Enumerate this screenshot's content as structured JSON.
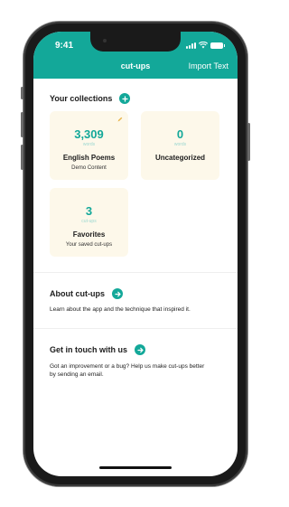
{
  "status_bar": {
    "time": "9:41"
  },
  "nav": {
    "title": "cut-ups",
    "action": "Import Text"
  },
  "collections": {
    "heading": "Your collections",
    "cards": [
      {
        "count": "3,309",
        "unit": "words",
        "title": "English Poems",
        "subtitle": "Demo Content"
      },
      {
        "count": "0",
        "unit": "words",
        "title": "Uncategorized",
        "subtitle": ""
      },
      {
        "count": "3",
        "unit": "cut-ups",
        "title": "Favorites",
        "subtitle": "Your saved cut-ups"
      }
    ]
  },
  "about": {
    "heading": "About cut-ups",
    "text": "Learn about the app and the technique that inspired it."
  },
  "contact": {
    "heading": "Get in touch with us",
    "text": "Got an improvement or a bug? Help us make cut-ups better by sending an email."
  },
  "colors": {
    "accent": "#13a899",
    "card_bg": "#fdf8ea",
    "edit_icon": "#e8b44a"
  }
}
